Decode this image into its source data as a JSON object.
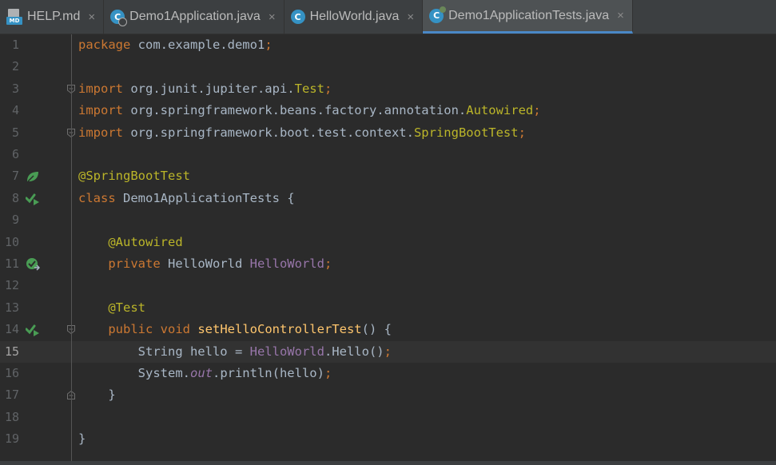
{
  "tabs": [
    {
      "label": "HELP.md",
      "icon": "markdown-file-icon",
      "badge": "MD",
      "active": false
    },
    {
      "label": "Demo1Application.java",
      "icon": "spring-boot-class-icon",
      "active": false
    },
    {
      "label": "HelloWorld.java",
      "icon": "java-class-icon",
      "active": false
    },
    {
      "label": "Demo1ApplicationTests.java",
      "icon": "test-class-icon",
      "active": true
    }
  ],
  "close_glyph": "×",
  "class_glyph": "C",
  "editor": {
    "current_line": 15,
    "lines": [
      {
        "num": "1",
        "tokens": [
          [
            "kw",
            "package"
          ],
          [
            "pl",
            " com.example.demo1"
          ],
          [
            "kw",
            ";"
          ]
        ]
      },
      {
        "num": "2",
        "tokens": []
      },
      {
        "num": "3",
        "tokens": [
          [
            "kw",
            "import"
          ],
          [
            "pl",
            " org.junit.jupiter.api."
          ],
          [
            "ann",
            "Test"
          ],
          [
            "kw",
            ";"
          ]
        ]
      },
      {
        "num": "4",
        "tokens": [
          [
            "kw",
            "import"
          ],
          [
            "pl",
            " org.springframework.beans.factory.annotation."
          ],
          [
            "ann",
            "Autowired"
          ],
          [
            "kw",
            ";"
          ]
        ]
      },
      {
        "num": "5",
        "tokens": [
          [
            "kw",
            "import"
          ],
          [
            "pl",
            " org.springframework.boot.test.context."
          ],
          [
            "ann",
            "SpringBootTest"
          ],
          [
            "kw",
            ";"
          ]
        ]
      },
      {
        "num": "6",
        "tokens": []
      },
      {
        "num": "7",
        "tokens": [
          [
            "ann",
            "@SpringBootTest"
          ]
        ]
      },
      {
        "num": "8",
        "tokens": [
          [
            "kw",
            "class"
          ],
          [
            "pl",
            " Demo1ApplicationTests {"
          ]
        ]
      },
      {
        "num": "9",
        "tokens": []
      },
      {
        "num": "10",
        "tokens": [
          [
            "pl",
            "    "
          ],
          [
            "ann",
            "@Autowired"
          ]
        ]
      },
      {
        "num": "11",
        "tokens": [
          [
            "pl",
            "    "
          ],
          [
            "kw",
            "private"
          ],
          [
            "pl",
            " HelloWorld "
          ],
          [
            "fld",
            "HelloWorld"
          ],
          [
            "kw",
            ";"
          ]
        ]
      },
      {
        "num": "12",
        "tokens": []
      },
      {
        "num": "13",
        "tokens": [
          [
            "pl",
            "    "
          ],
          [
            "ann",
            "@Test"
          ]
        ]
      },
      {
        "num": "14",
        "tokens": [
          [
            "pl",
            "    "
          ],
          [
            "kw",
            "public void"
          ],
          [
            "pl",
            " "
          ],
          [
            "fn",
            "setHelloControllerTest"
          ],
          [
            "pl",
            "() {"
          ]
        ]
      },
      {
        "num": "15",
        "tokens": [
          [
            "pl",
            "        String hello = "
          ],
          [
            "fld",
            "HelloWorld"
          ],
          [
            "pl",
            ".Hello()"
          ],
          [
            "kw",
            ";"
          ]
        ]
      },
      {
        "num": "16",
        "tokens": [
          [
            "pl",
            "        System."
          ],
          [
            "it",
            "out"
          ],
          [
            "pl",
            ".println(hello)"
          ],
          [
            "kw",
            ";"
          ]
        ]
      },
      {
        "num": "17",
        "tokens": [
          [
            "pl",
            "    }"
          ]
        ]
      },
      {
        "num": "18",
        "tokens": []
      },
      {
        "num": "19",
        "tokens": [
          [
            "pl",
            "}"
          ]
        ]
      }
    ]
  },
  "gutter_icons": [
    {
      "line": 7,
      "name": "spring-bean-icon"
    },
    {
      "line": 8,
      "name": "run-test-icon"
    },
    {
      "line": 11,
      "name": "autowired-navigate-icon"
    },
    {
      "line": 14,
      "name": "run-test-icon"
    }
  ],
  "fold_markers": [
    3,
    5,
    14,
    17
  ],
  "colors": {
    "background": "#2b2b2b",
    "keyword": "#cc7832",
    "annotation": "#bbb529",
    "field": "#9876aa",
    "method": "#ffc66d",
    "text": "#a9b7c6",
    "line_number": "#606366",
    "current_line": "#323232",
    "tab_bar": "#3c3f41",
    "active_tab_underline": "#4a88c7",
    "gutter_icon": "#499c54"
  }
}
